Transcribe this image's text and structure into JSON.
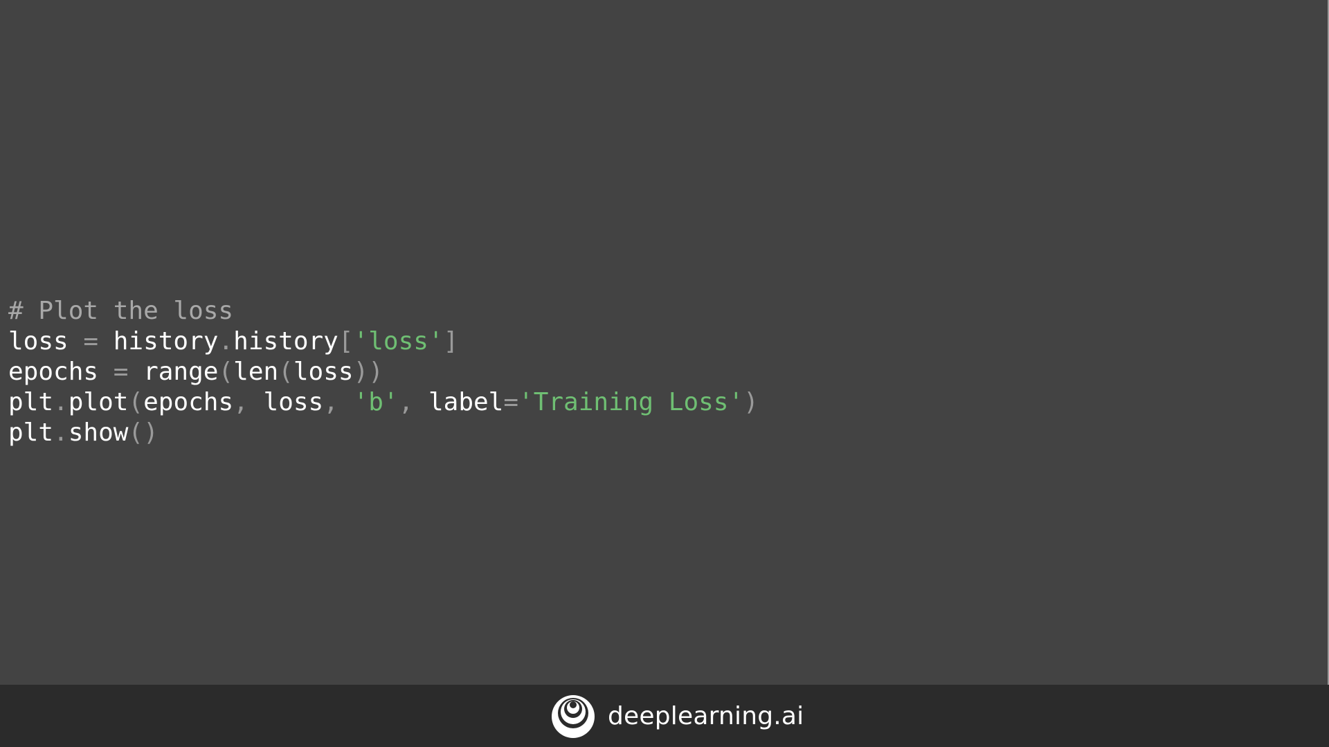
{
  "slide": {
    "code_lines": [
      [
        {
          "text": "# Plot the loss",
          "kind": "comment"
        }
      ],
      [
        {
          "text": "loss",
          "kind": "ident"
        },
        {
          "text": " = ",
          "kind": "punct"
        },
        {
          "text": "history",
          "kind": "ident"
        },
        {
          "text": ".",
          "kind": "punct"
        },
        {
          "text": "history",
          "kind": "ident"
        },
        {
          "text": "[",
          "kind": "punct"
        },
        {
          "text": "'loss'",
          "kind": "string"
        },
        {
          "text": "]",
          "kind": "punct"
        }
      ],
      [
        {
          "text": "epochs",
          "kind": "ident"
        },
        {
          "text": " = ",
          "kind": "punct"
        },
        {
          "text": "range",
          "kind": "ident"
        },
        {
          "text": "(",
          "kind": "punct"
        },
        {
          "text": "len",
          "kind": "ident"
        },
        {
          "text": "(",
          "kind": "punct"
        },
        {
          "text": "loss",
          "kind": "ident"
        },
        {
          "text": "))",
          "kind": "punct"
        }
      ],
      [
        {
          "text": "plt",
          "kind": "ident"
        },
        {
          "text": ".",
          "kind": "punct"
        },
        {
          "text": "plot",
          "kind": "ident"
        },
        {
          "text": "(",
          "kind": "punct"
        },
        {
          "text": "epochs",
          "kind": "ident"
        },
        {
          "text": ", ",
          "kind": "punct"
        },
        {
          "text": "loss",
          "kind": "ident"
        },
        {
          "text": ", ",
          "kind": "punct"
        },
        {
          "text": "'b'",
          "kind": "string"
        },
        {
          "text": ", ",
          "kind": "punct"
        },
        {
          "text": "label",
          "kind": "ident"
        },
        {
          "text": "=",
          "kind": "punct"
        },
        {
          "text": "'Training Loss'",
          "kind": "string"
        },
        {
          "text": ")",
          "kind": "punct"
        }
      ],
      [
        {
          "text": "plt",
          "kind": "ident"
        },
        {
          "text": ".",
          "kind": "punct"
        },
        {
          "text": "show",
          "kind": "ident"
        },
        {
          "text": "()",
          "kind": "punct"
        }
      ]
    ]
  },
  "footer": {
    "brand_name": "deeplearning.ai",
    "logo_icon": "deeplearning-ai-logo-icon"
  },
  "colors": {
    "background": "#434343",
    "footer_background": "#2b2b2b",
    "code_text": "#ffffff",
    "comment": "#a8a8a8",
    "punctuation": "#9a9a9a",
    "string_literal": "#6fbf73"
  }
}
